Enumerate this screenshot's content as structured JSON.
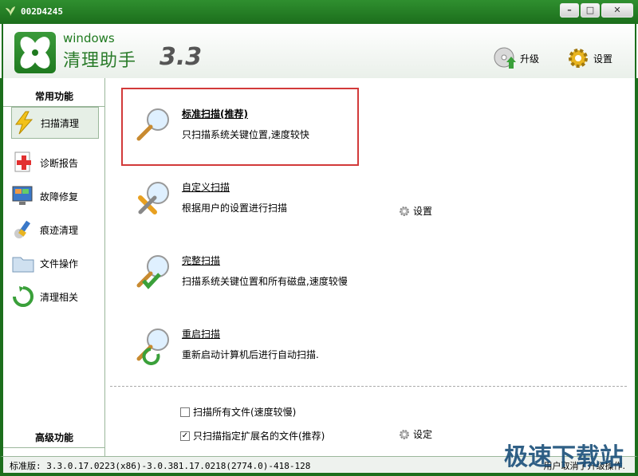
{
  "window": {
    "title": "002D4245"
  },
  "header": {
    "brand_small": "windows",
    "brand_name": "清理助手",
    "version": "3.3",
    "upgrade_label": "升级",
    "settings_label": "设置"
  },
  "sidebar": {
    "common_label": "常用功能",
    "advanced_label": "高级功能",
    "items": [
      {
        "label": "扫描清理"
      },
      {
        "label": "诊断报告"
      },
      {
        "label": "故障修复"
      },
      {
        "label": "痕迹清理"
      },
      {
        "label": "文件操作"
      },
      {
        "label": "清理相关"
      }
    ]
  },
  "options": [
    {
      "title": "标准扫描(推荐)",
      "desc": "只扫描系统关键位置,速度较快"
    },
    {
      "title": "自定义扫描",
      "desc": "根据用户的设置进行扫描",
      "link": "设置"
    },
    {
      "title": "完整扫描",
      "desc": "扫描系统关键位置和所有磁盘,速度较慢"
    },
    {
      "title": "重启扫描",
      "desc": "重新启动计算机后进行自动扫描."
    }
  ],
  "checks": [
    {
      "label": "扫描所有文件(速度较慢)",
      "checked": false
    },
    {
      "label": "只扫描指定扩展名的文件(推荐)",
      "checked": true,
      "link": "设定"
    }
  ],
  "status": {
    "left": "标准版: 3.3.0.17.0223(x86)-3.0.381.17.0218(2774.0)-418-128",
    "right": "用户取消了升级操作."
  },
  "watermark": "极速下载站",
  "colors": {
    "accent": "#1c6e1c",
    "highlight": "#d23a3a"
  }
}
